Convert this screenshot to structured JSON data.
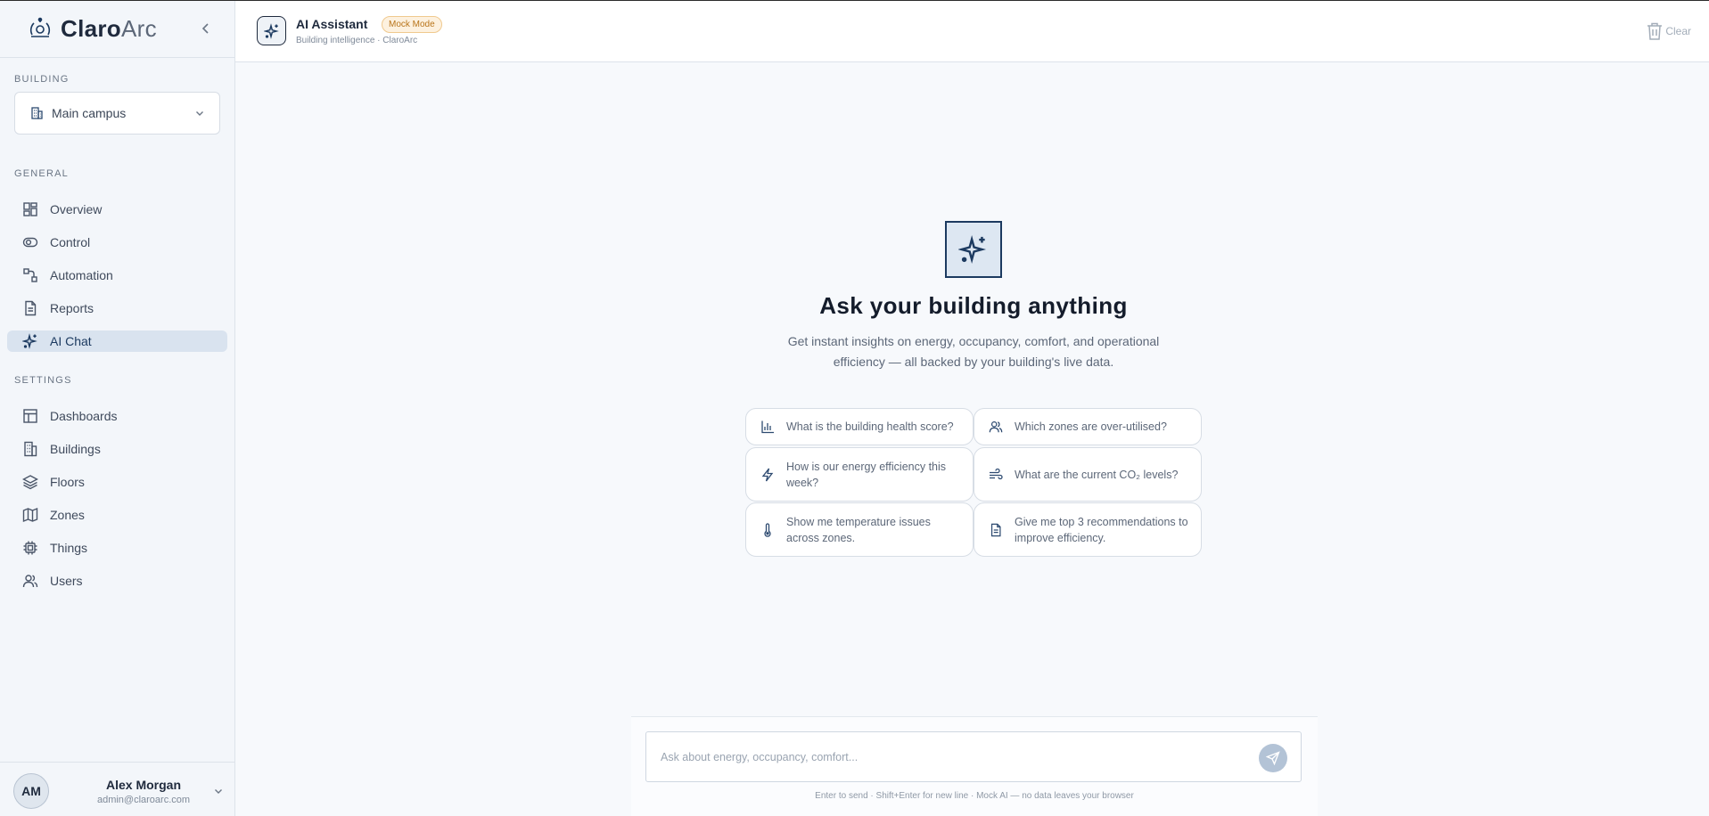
{
  "brand": {
    "name_strong": "Claro",
    "name_light": "Arc"
  },
  "sidebar": {
    "building_label": "Building",
    "building_selected": "Main campus",
    "general_label": "General",
    "general_items": [
      {
        "label": "Overview",
        "icon": "grid-icon"
      },
      {
        "label": "Control",
        "icon": "toggle-icon"
      },
      {
        "label": "Automation",
        "icon": "workflow-icon"
      },
      {
        "label": "Reports",
        "icon": "document-icon"
      },
      {
        "label": "AI Chat",
        "icon": "sparkle-icon",
        "active": true
      }
    ],
    "settings_label": "Settings",
    "settings_items": [
      {
        "label": "Dashboards",
        "icon": "layout-icon"
      },
      {
        "label": "Buildings",
        "icon": "building-icon"
      },
      {
        "label": "Floors",
        "icon": "layers-icon"
      },
      {
        "label": "Zones",
        "icon": "map-icon"
      },
      {
        "label": "Things",
        "icon": "chip-icon"
      },
      {
        "label": "Users",
        "icon": "users-icon"
      }
    ]
  },
  "user": {
    "initials": "AM",
    "name": "Alex Morgan",
    "email": "admin@claroarc.com"
  },
  "header": {
    "title": "AI Assistant",
    "badge": "Mock Mode",
    "subtitle": "Building intelligence · ClaroArc",
    "clear_label": "Clear"
  },
  "hero": {
    "title": "Ask your building anything",
    "subtitle": "Get instant insights on energy, occupancy, comfort, and operational efficiency — all backed by your building's live data."
  },
  "suggestions": [
    {
      "text": "What is the building health score?",
      "icon": "bar-chart-icon"
    },
    {
      "text": "Which zones are over-utilised?",
      "icon": "users-icon"
    },
    {
      "text": "How is our energy efficiency this week?",
      "icon": "lightning-icon"
    },
    {
      "text": "What are the current CO₂ levels?",
      "icon": "wind-icon"
    },
    {
      "text": "Show me temperature issues across zones.",
      "icon": "thermometer-icon"
    },
    {
      "text": "Give me top 3 recommendations to improve efficiency.",
      "icon": "document-icon"
    }
  ],
  "composer": {
    "placeholder": "Ask about energy, occupancy, comfort...",
    "value": "",
    "hint": "Enter to send · Shift+Enter for new line · Mock AI — no data leaves your browser"
  },
  "colors": {
    "accent": "#1c3a60",
    "active_nav_bg": "#d9e3ef",
    "badge_bg": "#fdf1df",
    "badge_text": "#b8741a",
    "send_button": "#b3c3d6"
  }
}
